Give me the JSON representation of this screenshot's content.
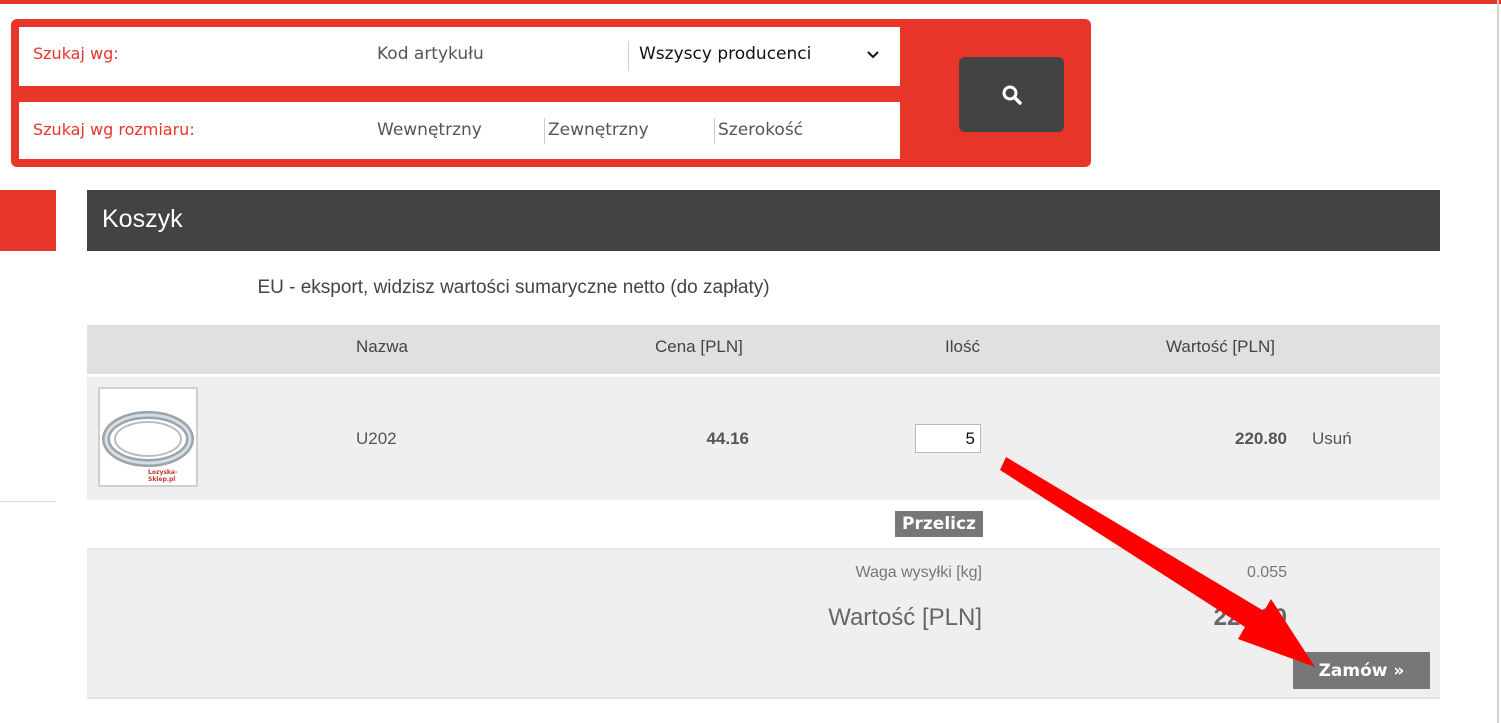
{
  "search": {
    "by_label": "Szukaj wg:",
    "code_placeholder": "Kod artykułu",
    "manufacturer_selected": "Wszyscy producenci",
    "by_size_label": "Szukaj wg rozmiaru:",
    "inner_placeholder": "Wewnętrzny",
    "outer_placeholder": "Zewnętrzny",
    "width_placeholder": "Szerokość"
  },
  "cart": {
    "title": "Koszyk",
    "notice": "EU - eksport, widzisz wartości sumaryczne netto (do zapłaty)",
    "columns": {
      "name": "Nazwa",
      "price": "Cena [PLN]",
      "qty": "Ilość",
      "value": "Wartość [PLN]"
    },
    "items": [
      {
        "name": "U202",
        "price": "44.16",
        "qty": "5",
        "value": "220.80",
        "remove": "Usuń",
        "thumb_brand": "Lozyska-Sklep.pl"
      }
    ],
    "recalc_label": "Przelicz",
    "weight_label": "Waga wysyłki [kg]",
    "weight_value": "0.055",
    "total_label": "Wartość [PLN]",
    "total_value": "220.80",
    "order_label": "Zamów »"
  },
  "colors": {
    "accent": "#e8352a",
    "dark": "#434343",
    "button": "#777777",
    "arrow": "#ff0000"
  },
  "icons": {
    "search": "search-icon",
    "dropdown": "chevron-down-icon",
    "annotation": "arrow-annotation"
  }
}
